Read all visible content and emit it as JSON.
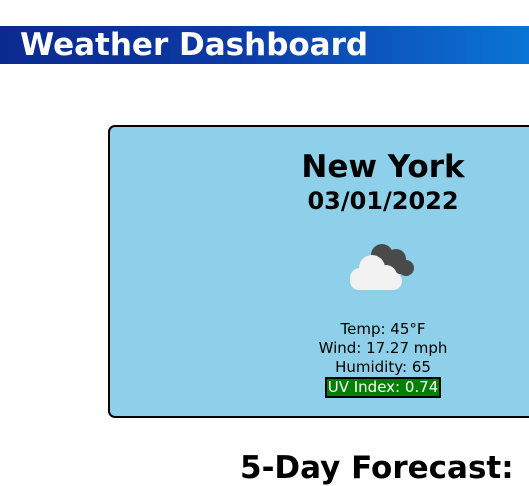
{
  "header": {
    "title": "Weather Dashboard"
  },
  "current": {
    "city": "New York",
    "date": "03/01/2022",
    "icon": "cloudy-icon",
    "temp": "Temp: 45°F",
    "wind": "Wind: 17.27 mph",
    "humidity": "Humidity: 65",
    "uv": "UV Index: 0.74",
    "uv_color": "#008000",
    "card_color": "#8ecfe9"
  },
  "forecast": {
    "title": "5-Day Forecast:"
  },
  "colors": {
    "header_start": "#0b2a8f",
    "header_end": "#0b74d6"
  }
}
